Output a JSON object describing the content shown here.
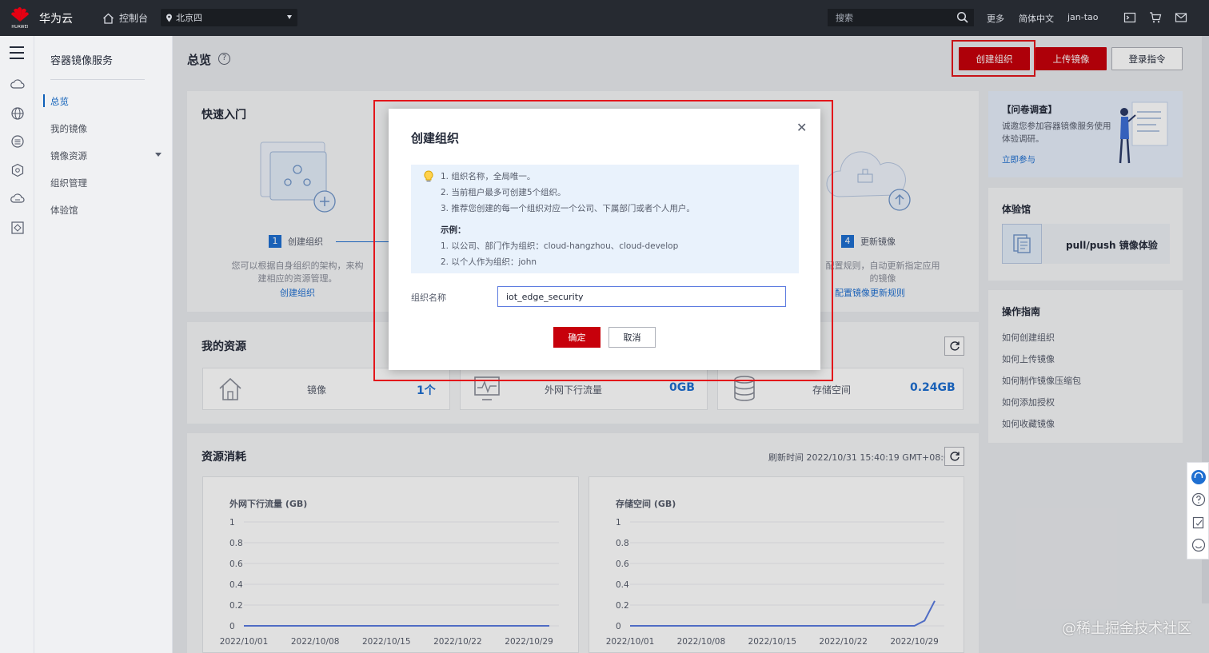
{
  "topbar": {
    "logo_text": "HUAWEI",
    "brand": "华为云",
    "console": "控制台",
    "region": "北京四",
    "search_placeholder": "搜索",
    "more": "更多",
    "language": "简体中文",
    "user": "jan-tao"
  },
  "service_nav": {
    "title": "容器镜像服务",
    "items": [
      {
        "label": "总览",
        "active": true
      },
      {
        "label": "我的镜像"
      },
      {
        "label": "镜像资源",
        "has_dropdown": true
      },
      {
        "label": "组织管理"
      },
      {
        "label": "体验馆"
      }
    ]
  },
  "page": {
    "title": "总览",
    "buttons": {
      "create_org": "创建组织",
      "upload_image": "上传镜像",
      "login_cmd": "登录指令"
    }
  },
  "quick_start": {
    "title": "快速入门",
    "step1": {
      "num": "1",
      "label": "创建组织",
      "desc_line1": "您可以根据自身组织的架构，来构",
      "desc_line2": "建相应的资源管理。",
      "link": "创建组织"
    },
    "step4": {
      "num": "4",
      "label": "更新镜像",
      "desc_line1": "配置规则，自动更新指定应用",
      "desc_line2": "的镜像",
      "link": "配置镜像更新规则"
    }
  },
  "my_resources": {
    "title": "我的资源",
    "items": [
      {
        "label": "镜像",
        "value": "1个"
      },
      {
        "label": "外网下行流量",
        "value": "0GB"
      },
      {
        "label": "存储空间",
        "value": "0.24GB"
      }
    ]
  },
  "consumption": {
    "title": "资源消耗",
    "refresh_time": "刷新时间 2022/10/31 15:40:19 GMT+08:00"
  },
  "chart_data": [
    {
      "type": "line",
      "title": "外网下行流量 (GB)",
      "ylim": [
        0,
        1
      ],
      "y_ticks": [
        "1",
        "0.8",
        "0.6",
        "0.4",
        "0.2",
        "0"
      ],
      "x_ticks": [
        "2022/10/01",
        "2022/10/08",
        "2022/10/15",
        "2022/10/22",
        "2022/10/29"
      ],
      "series": [
        {
          "x": [
            "2022/10/01",
            "2022/10/31"
          ],
          "values": [
            0,
            0
          ]
        }
      ]
    },
    {
      "type": "line",
      "title": "存储空间 (GB)",
      "ylim": [
        0,
        1
      ],
      "y_ticks": [
        "1",
        "0.8",
        "0.6",
        "0.4",
        "0.2",
        "0"
      ],
      "x_ticks": [
        "2022/10/01",
        "2022/10/08",
        "2022/10/15",
        "2022/10/22",
        "2022/10/29"
      ],
      "series": [
        {
          "x": [
            "2022/10/01",
            "2022/10/29",
            "2022/10/30",
            "2022/10/31"
          ],
          "values": [
            0,
            0,
            0.05,
            0.24
          ]
        }
      ]
    }
  ],
  "right_sidebar": {
    "survey": {
      "title": "【问卷调查】",
      "line1": "诚邀您参加容器镜像服务使用",
      "line2": "体验调研。",
      "link": "立即参与"
    },
    "lab": {
      "title": "体验馆",
      "item": "pull/push 镜像体验"
    },
    "guide": {
      "title": "操作指南",
      "links": [
        "如何创建组织",
        "如何上传镜像",
        "如何制作镜像压缩包",
        "如何添加授权",
        "如何收藏镜像"
      ]
    }
  },
  "dialog": {
    "title": "创建组织",
    "tips": [
      "1. 组织名称，全局唯一。",
      "2. 当前租户最多可创建5个组织。",
      "3. 推荐您创建的每一个组织对应一个公司、下属部门或者个人用户。",
      "示例：",
      "1. 以公司、部门作为组织：cloud-hangzhou、cloud-develop",
      "2. 以个人作为组织：john"
    ],
    "field_label": "组织名称",
    "field_value": "iot_edge_security",
    "confirm": "确定",
    "cancel": "取消"
  },
  "watermark": "@稀土掘金技术社区",
  "colors": {
    "brand_red": "#c7000b",
    "link_blue": "#1e6fd1",
    "highlight_box": "#e3161b"
  }
}
